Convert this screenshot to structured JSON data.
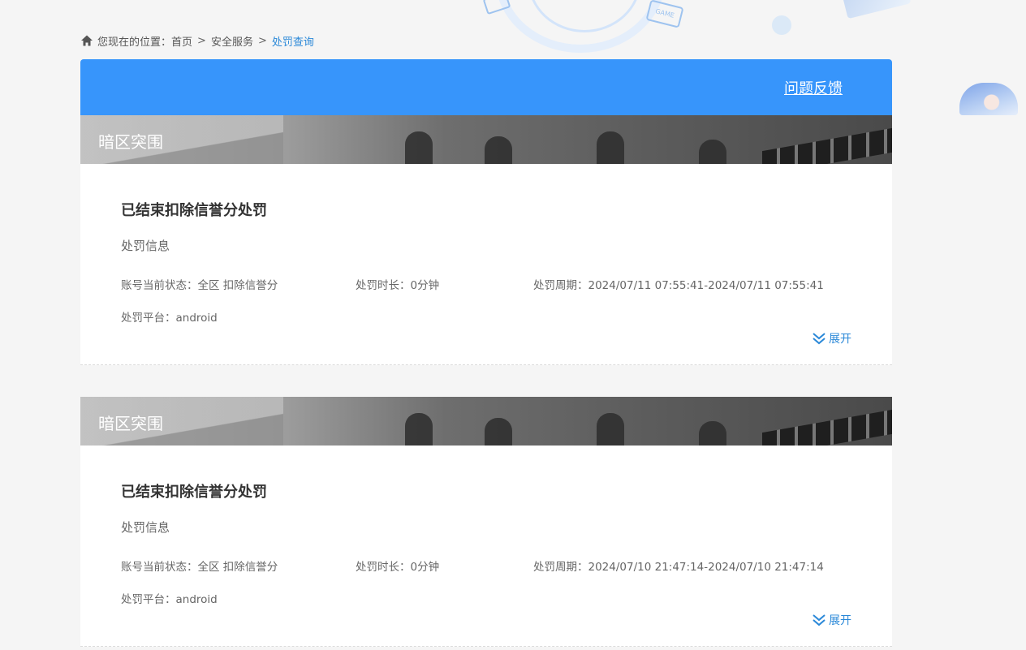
{
  "breadcrumb": {
    "prefix": "您现在的位置：",
    "items": [
      "首页",
      "安全服务"
    ],
    "separator": ">",
    "current": "处罚查询"
  },
  "header": {
    "feedback_label": "问题反馈"
  },
  "decor": {
    "game_tag": "GAME"
  },
  "labels": {
    "account_status": "账号当前状态：",
    "duration": "处罚时长：",
    "period": "处罚周期：",
    "platform": "处罚平台：",
    "expand": "展开",
    "section": "处罚信息"
  },
  "records": [
    {
      "game": "暗区突围",
      "status_title": "已结束扣除信誉分处罚",
      "account_status": "全区 扣除信誉分",
      "duration": "0分钟",
      "period": "2024/07/11 07:55:41-2024/07/11 07:55:41",
      "platform": "android"
    },
    {
      "game": "暗区突围",
      "status_title": "已结束扣除信誉分处罚",
      "account_status": "全区 扣除信誉分",
      "duration": "0分钟",
      "period": "2024/07/10 21:47:14-2024/07/10 21:47:14",
      "platform": "android"
    }
  ],
  "colors": {
    "accent": "#3795fb",
    "link": "#2a88d8",
    "background": "#f5f5f5"
  }
}
